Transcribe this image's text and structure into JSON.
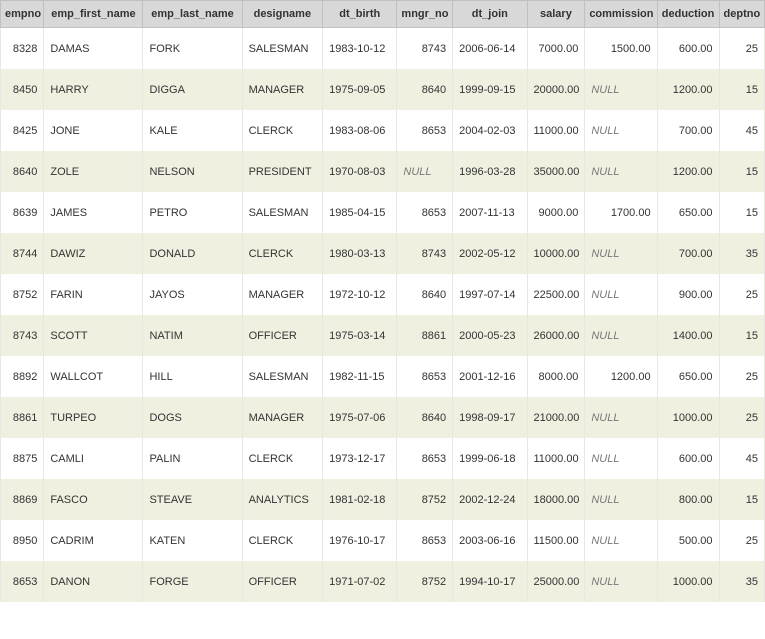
{
  "table": {
    "headers": [
      "empno",
      "emp_first_name",
      "emp_last_name",
      "designame",
      "dt_birth",
      "mngr_no",
      "dt_join",
      "salary",
      "commission",
      "deduction",
      "deptno"
    ],
    "rows": [
      {
        "empno": "8328",
        "first": "DAMAS",
        "last": "FORK",
        "desig": "SALESMAN",
        "birth": "1983-10-12",
        "mngr": "8743",
        "join": "2006-06-14",
        "salary": "7000.00",
        "comm": "1500.00",
        "ded": "600.00",
        "dept": "25"
      },
      {
        "empno": "8450",
        "first": "HARRY",
        "last": "DIGGA",
        "desig": "MANAGER",
        "birth": "1975-09-05",
        "mngr": "8640",
        "join": "1999-09-15",
        "salary": "20000.00",
        "comm": null,
        "ded": "1200.00",
        "dept": "15"
      },
      {
        "empno": "8425",
        "first": "JONE",
        "last": "KALE",
        "desig": "CLERCK",
        "birth": "1983-08-06",
        "mngr": "8653",
        "join": "2004-02-03",
        "salary": "11000.00",
        "comm": null,
        "ded": "700.00",
        "dept": "45"
      },
      {
        "empno": "8640",
        "first": "ZOLE",
        "last": "NELSON",
        "desig": "PRESIDENT",
        "birth": "1970-08-03",
        "mngr": null,
        "join": "1996-03-28",
        "salary": "35000.00",
        "comm": null,
        "ded": "1200.00",
        "dept": "15"
      },
      {
        "empno": "8639",
        "first": "JAMES",
        "last": "PETRO",
        "desig": "SALESMAN",
        "birth": "1985-04-15",
        "mngr": "8653",
        "join": "2007-11-13",
        "salary": "9000.00",
        "comm": "1700.00",
        "ded": "650.00",
        "dept": "15"
      },
      {
        "empno": "8744",
        "first": "DAWIZ",
        "last": "DONALD",
        "desig": "CLERCK",
        "birth": "1980-03-13",
        "mngr": "8743",
        "join": "2002-05-12",
        "salary": "10000.00",
        "comm": null,
        "ded": "700.00",
        "dept": "35"
      },
      {
        "empno": "8752",
        "first": "FARIN",
        "last": "JAYOS",
        "desig": "MANAGER",
        "birth": "1972-10-12",
        "mngr": "8640",
        "join": "1997-07-14",
        "salary": "22500.00",
        "comm": null,
        "ded": "900.00",
        "dept": "25"
      },
      {
        "empno": "8743",
        "first": "SCOTT",
        "last": "NATIM",
        "desig": "OFFICER",
        "birth": "1975-03-14",
        "mngr": "8861",
        "join": "2000-05-23",
        "salary": "26000.00",
        "comm": null,
        "ded": "1400.00",
        "dept": "15"
      },
      {
        "empno": "8892",
        "first": "WALLCOT",
        "last": "HILL",
        "desig": "SALESMAN",
        "birth": "1982-11-15",
        "mngr": "8653",
        "join": "2001-12-16",
        "salary": "8000.00",
        "comm": "1200.00",
        "ded": "650.00",
        "dept": "25"
      },
      {
        "empno": "8861",
        "first": "TURPEO",
        "last": "DOGS",
        "desig": "MANAGER",
        "birth": "1975-07-06",
        "mngr": "8640",
        "join": "1998-09-17",
        "salary": "21000.00",
        "comm": null,
        "ded": "1000.00",
        "dept": "25"
      },
      {
        "empno": "8875",
        "first": "CAMLI",
        "last": "PALIN",
        "desig": "CLERCK",
        "birth": "1973-12-17",
        "mngr": "8653",
        "join": "1999-06-18",
        "salary": "11000.00",
        "comm": null,
        "ded": "600.00",
        "dept": "45"
      },
      {
        "empno": "8869",
        "first": "FASCO",
        "last": "STEAVE",
        "desig": "ANALYTICS",
        "birth": "1981-02-18",
        "mngr": "8752",
        "join": "2002-12-24",
        "salary": "18000.00",
        "comm": null,
        "ded": "800.00",
        "dept": "15"
      },
      {
        "empno": "8950",
        "first": "CADRIM",
        "last": "KATEN",
        "desig": "CLERCK",
        "birth": "1976-10-17",
        "mngr": "8653",
        "join": "2003-06-16",
        "salary": "11500.00",
        "comm": null,
        "ded": "500.00",
        "dept": "25"
      },
      {
        "empno": "8653",
        "first": "DANON",
        "last": "FORGE",
        "desig": "OFFICER",
        "birth": "1971-07-02",
        "mngr": "8752",
        "join": "1994-10-17",
        "salary": "25000.00",
        "comm": null,
        "ded": "1000.00",
        "dept": "35"
      }
    ],
    "null_label": "NULL"
  }
}
